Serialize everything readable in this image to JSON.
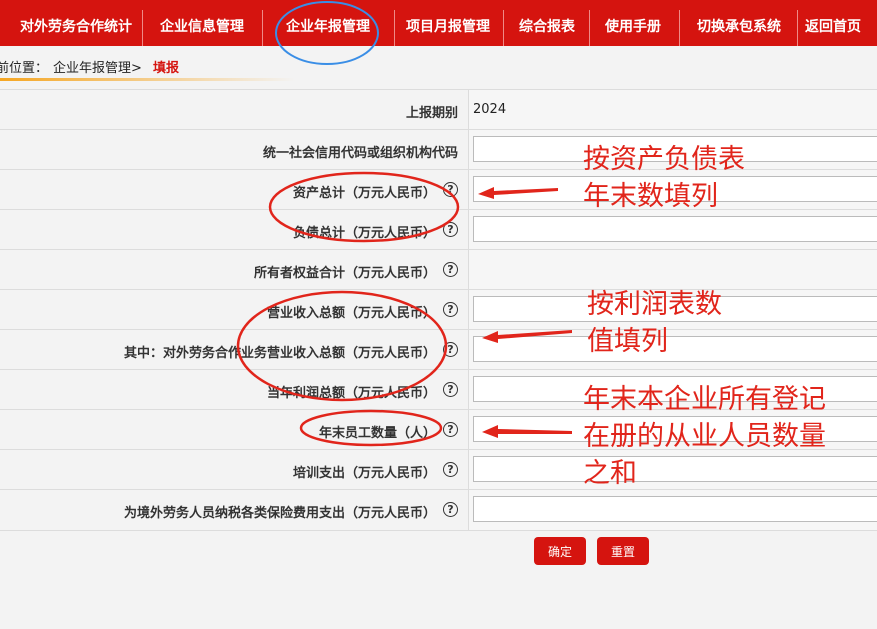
{
  "nav": {
    "items": [
      {
        "label": "对外劳务合作统计"
      },
      {
        "label": "企业信息管理"
      },
      {
        "label": "企业年报管理"
      },
      {
        "label": "项目月报管理"
      },
      {
        "label": "综合报表"
      },
      {
        "label": "使用手册"
      },
      {
        "label": "切换承包系统"
      },
      {
        "label": "返回首页"
      }
    ]
  },
  "breadcrumb": {
    "prefix": "前位置：",
    "section": "企业年报管理>",
    "current": "填报"
  },
  "form": {
    "rows": [
      {
        "label": "上报期别",
        "value": "2024"
      },
      {
        "label": "统一社会信用代码或组织机构代码",
        "value": ""
      },
      {
        "label": "资产总计（万元人民币）",
        "value": ""
      },
      {
        "label": "负债总计（万元人民币）",
        "value": ""
      },
      {
        "label": "所有者权益合计（万元人民币）",
        "value": ""
      },
      {
        "label": "营业收入总额（万元人民币）",
        "value": ""
      },
      {
        "label": "其中：对外劳务合作业务营业收入总额（万元人民币）",
        "value": ""
      },
      {
        "label": "当年利润总额（万元人民币）",
        "value": ""
      },
      {
        "label": "年末员工数量（人）",
        "value": ""
      },
      {
        "label": "培训支出（万元人民币）",
        "value": ""
      },
      {
        "label": "为境外劳务人员纳税各类保险费用支出（万元人民币）",
        "value": ""
      }
    ],
    "help_glyph": "?"
  },
  "buttons": {
    "confirm": "确定",
    "reset": "重置"
  },
  "annotations": {
    "note1": [
      "按资产负债表",
      "年末数填列"
    ],
    "note2": [
      "按利润表数",
      "值填列"
    ],
    "note3": [
      "年末本企业所有登记",
      "在册的从业人员数量",
      "之和"
    ]
  },
  "colors": {
    "brand": "#d5140f",
    "annotation": "#e1251b",
    "circle_blue": "#3a8ee6"
  }
}
